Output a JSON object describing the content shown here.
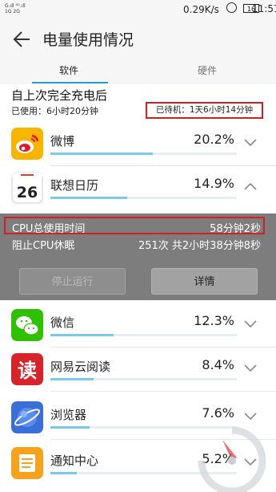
{
  "status_bar": {
    "signal_line1": "G.ıll ⁴ᴳ.ıll",
    "signal_line2": "1G 2G",
    "network_speed": "0.29K/s",
    "battery": "16",
    "time": "11:51"
  },
  "header": {
    "title": "电量使用情况"
  },
  "tabs": [
    {
      "label": "软件",
      "active": true
    },
    {
      "label": "硬件",
      "active": false
    }
  ],
  "summary": {
    "title": "自上次完全充电后",
    "used": "已使用：6小时20分钟",
    "standby": "已待机：1天6小时14分钟"
  },
  "apps": [
    {
      "name": "微博",
      "percent": "20.2%",
      "bar_fraction": 0.55,
      "icon": "weibo-icon",
      "expanded": false
    },
    {
      "name": "联想日历",
      "percent": "14.9%",
      "bar_fraction": 0.41,
      "icon": "calendar-icon",
      "icon_text": "26",
      "expanded": true
    },
    {
      "name": "微信",
      "percent": "12.3%",
      "bar_fraction": 0.34,
      "icon": "wechat-icon",
      "expanded": false
    },
    {
      "name": "网易云阅读",
      "percent": "8.4%",
      "bar_fraction": 0.23,
      "icon": "netease-reader-icon",
      "icon_text": "读",
      "expanded": false
    },
    {
      "name": "浏览器",
      "percent": "7.6%",
      "bar_fraction": 0.21,
      "icon": "browser-icon",
      "expanded": false
    },
    {
      "name": "通知中心",
      "percent": "5.2%",
      "bar_fraction": 0.14,
      "icon": "notification-center-icon",
      "expanded": false
    }
  ],
  "detail": {
    "cpu_label": "CPU总使用时间",
    "cpu_value": "58分钟2秒",
    "block_label": "阻止CPU休眠",
    "block_value": "251次 共2小时38分钟8秒",
    "stop_button": "停止运行",
    "details_button": "详情"
  },
  "colors": {
    "accent": "#2a9bd8",
    "highlight_border": "#d21f1f",
    "detail_panel": "#7d7d7d",
    "bar": "#7ac8ec"
  }
}
